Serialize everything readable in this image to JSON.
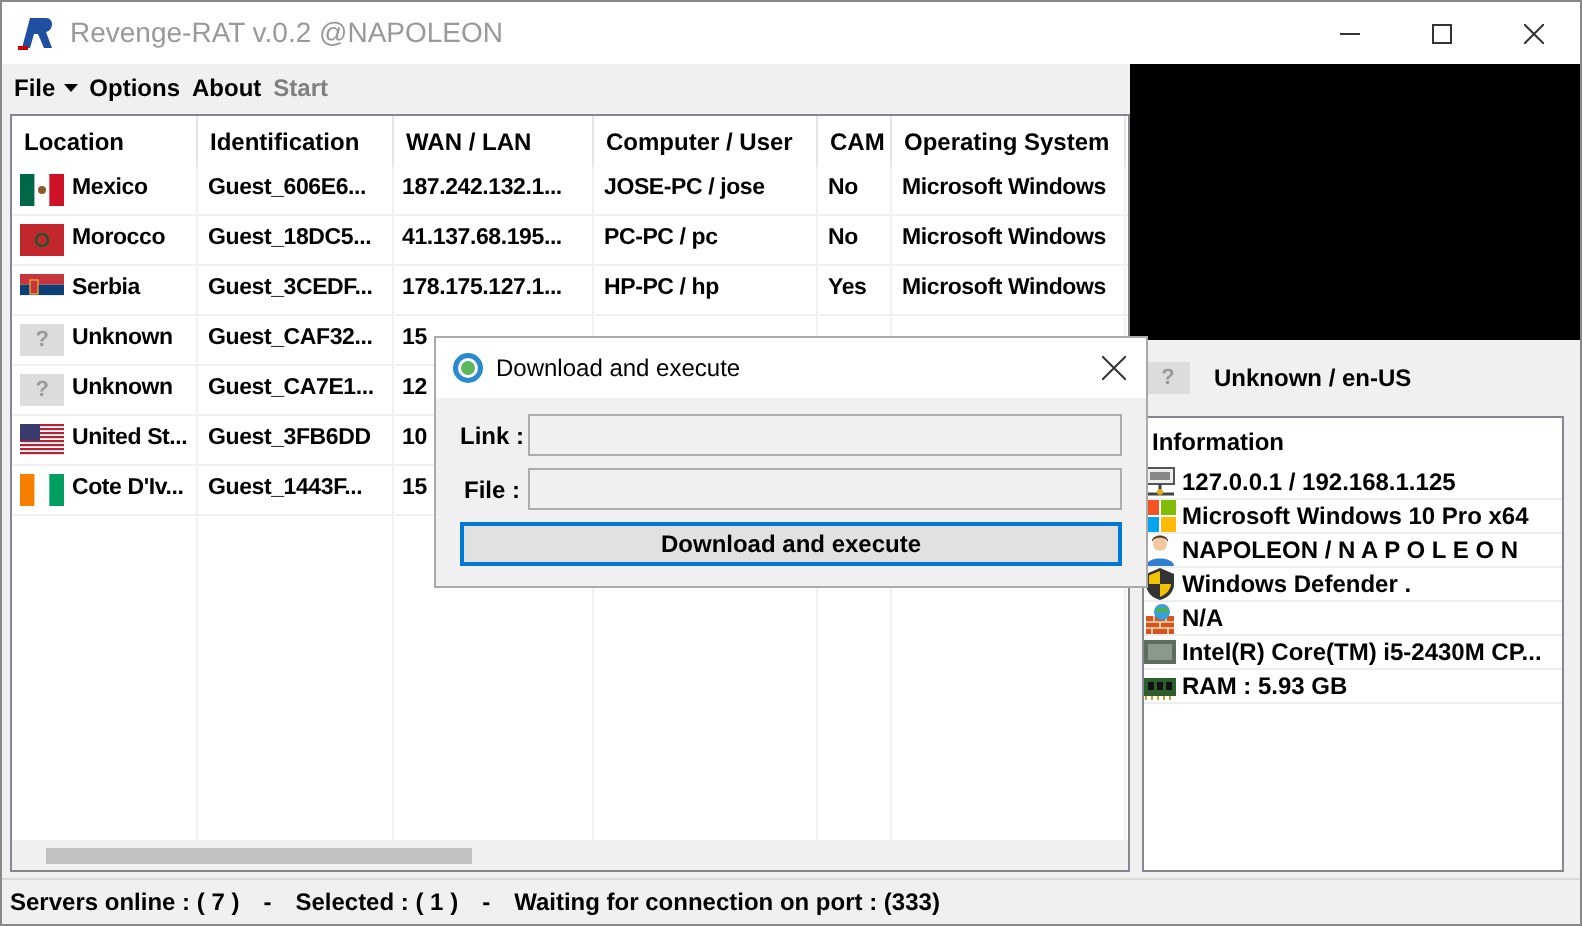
{
  "window": {
    "title": "Revenge-RAT v.0.2 @NAPOLEON"
  },
  "menu": [
    {
      "label": "File",
      "kind": "dropdown",
      "disabled": false
    },
    {
      "label": "Options",
      "kind": "plain",
      "disabled": false
    },
    {
      "label": "About",
      "kind": "plain",
      "disabled": false
    },
    {
      "label": "Start",
      "kind": "plain",
      "disabled": true
    }
  ],
  "table": {
    "columns": [
      "Location",
      "Identification",
      "WAN / LAN",
      "Computer / User",
      "CAM",
      "Operating System"
    ],
    "rows": [
      {
        "kind": "mexico",
        "cells": [
          "Mexico",
          "Guest_606E6...",
          "187.242.132.1...",
          "JOSE-PC / jose",
          "No",
          "Microsoft Windows"
        ]
      },
      {
        "kind": "morocco",
        "cells": [
          "Morocco",
          "Guest_18DC5...",
          "41.137.68.195...",
          "PC-PC / pc",
          "No",
          "Microsoft Windows"
        ]
      },
      {
        "kind": "serbia",
        "cells": [
          "Serbia",
          "Guest_3CEDF...",
          "178.175.127.1...",
          "HP-PC / hp",
          "Yes",
          "Microsoft Windows"
        ]
      },
      {
        "kind": "unknown",
        "flag_text": "?",
        "cells": [
          "Unknown",
          "Guest_CAF32...",
          "15"
        ]
      },
      {
        "kind": "unknown",
        "flag_text": "?",
        "cells": [
          "Unknown",
          "Guest_CA7E1...",
          "12"
        ]
      },
      {
        "kind": "usa",
        "cells": [
          "United St...",
          "Guest_3FB6DD",
          "10"
        ]
      },
      {
        "kind": "ivory-coast",
        "cells": [
          "Cote D'Iv...",
          "Guest_1443F...",
          "15"
        ]
      }
    ]
  },
  "details": {
    "flag_text": "?",
    "location": "Unknown / en-US",
    "heading": "Information",
    "items": [
      {
        "kind": "network",
        "text": "127.0.0.1 / 192.168.1.125"
      },
      {
        "kind": "windows",
        "text": "Microsoft Windows 10 Pro x64"
      },
      {
        "kind": "user",
        "text": "NAPOLEON / N A P O L E O N"
      },
      {
        "kind": "shield",
        "text": "Windows Defender ."
      },
      {
        "kind": "firewall",
        "text": "N/A"
      },
      {
        "kind": "cpu",
        "text": "Intel(R) Core(TM) i5-2430M CP..."
      },
      {
        "kind": "ram",
        "text": "RAM : 5.93 GB"
      }
    ]
  },
  "dialog": {
    "title": "Download and execute",
    "fields": [
      {
        "label": "Link :"
      },
      {
        "label": "File :"
      }
    ],
    "button": "Download and execute"
  },
  "status_bar": [
    "Servers online : ( 7 )",
    "-",
    "Selected : ( 1 )",
    "-",
    "Waiting for connection on port : (333)"
  ]
}
